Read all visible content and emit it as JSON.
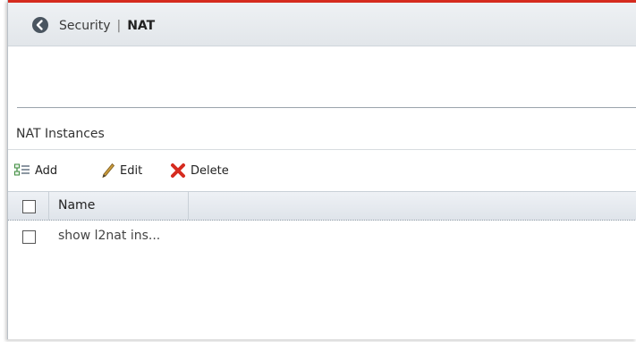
{
  "header": {
    "breadcrumb_parent": "Security",
    "breadcrumb_separator": "|",
    "breadcrumb_current": "NAT"
  },
  "section": {
    "title": "NAT Instances"
  },
  "toolbar": {
    "add_label": "Add",
    "edit_label": "Edit",
    "delete_label": "Delete"
  },
  "table": {
    "columns": [
      "Name"
    ],
    "rows": [
      {
        "name": "show l2nat ins..."
      }
    ]
  },
  "colors": {
    "accent_line": "#d52b1e",
    "delete_icon": "#d62b1f"
  },
  "icons": {
    "back": "back-arrow-icon",
    "add": "add-list-icon",
    "edit": "pencil-icon",
    "delete": "red-x-icon"
  }
}
